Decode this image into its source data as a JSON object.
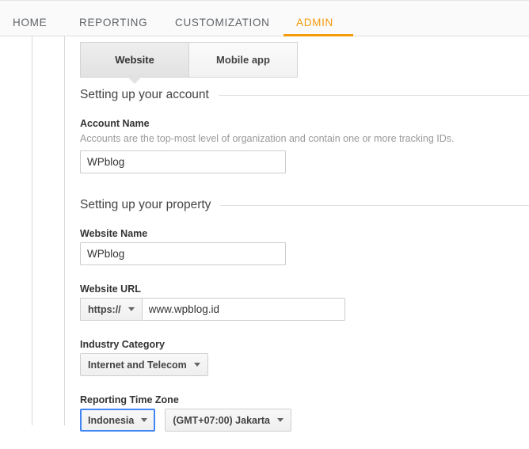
{
  "topnav": {
    "items": [
      {
        "label": "HOME",
        "active": false
      },
      {
        "label": "REPORTING",
        "active": false
      },
      {
        "label": "CUSTOMIZATION",
        "active": false
      },
      {
        "label": "ADMIN",
        "active": true
      }
    ],
    "accent_color": "#f49b0b"
  },
  "tabs": [
    {
      "label": "Website",
      "selected": true
    },
    {
      "label": "Mobile app",
      "selected": false
    }
  ],
  "sections": {
    "account": {
      "heading": "Setting up your account",
      "account_name": {
        "label": "Account Name",
        "help": "Accounts are the top-most level of organization and contain one or more tracking IDs.",
        "value": "WPblog",
        "placeholder": ""
      }
    },
    "property": {
      "heading": "Setting up your property",
      "website_name": {
        "label": "Website Name",
        "value": "WPblog",
        "placeholder": ""
      },
      "website_url": {
        "label": "Website URL",
        "protocol": "https://",
        "value": "www.wpblog.id",
        "placeholder": ""
      },
      "industry_category": {
        "label": "Industry Category",
        "value": "Internet and Telecom"
      },
      "reporting_time_zone": {
        "label": "Reporting Time Zone",
        "country": "Indonesia",
        "zone": "(GMT+07:00) Jakarta",
        "country_focused": true,
        "focus_color": "#4285f4"
      }
    }
  },
  "icons": {
    "chevron_down": "chevron-down-icon"
  }
}
